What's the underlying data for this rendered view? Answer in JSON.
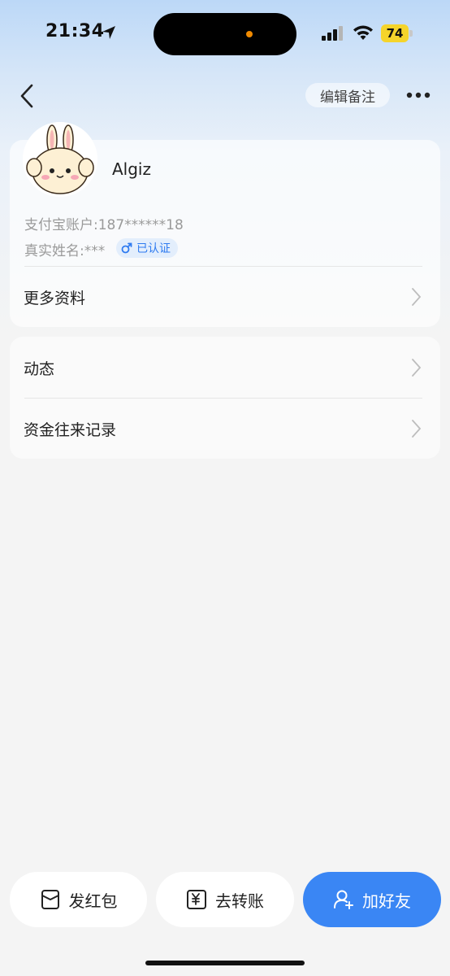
{
  "status_bar": {
    "time": "21:34",
    "battery_level": "74",
    "icons": [
      "location-arrow-icon",
      "signal-icon",
      "wifi-icon",
      "battery-icon"
    ],
    "battery_color": "#f5d42b"
  },
  "header": {
    "edit_note_label": "编辑备注",
    "icons": [
      "back-icon",
      "more-icon"
    ]
  },
  "profile": {
    "name": "Algiz",
    "account_line": "支付宝账户:187******18",
    "realname_line": "真实姓名:***",
    "verified_badge": "已认证",
    "gender_icon": "male-icon",
    "more_info_label": "更多资料"
  },
  "list": {
    "items": [
      {
        "label": "动态"
      },
      {
        "label": "资金往来记录"
      }
    ]
  },
  "bottom_actions": {
    "red_packet_label": "发红包",
    "transfer_label": "去转账",
    "add_friend_label": "加好友",
    "accent_color": "#3a86f4"
  }
}
